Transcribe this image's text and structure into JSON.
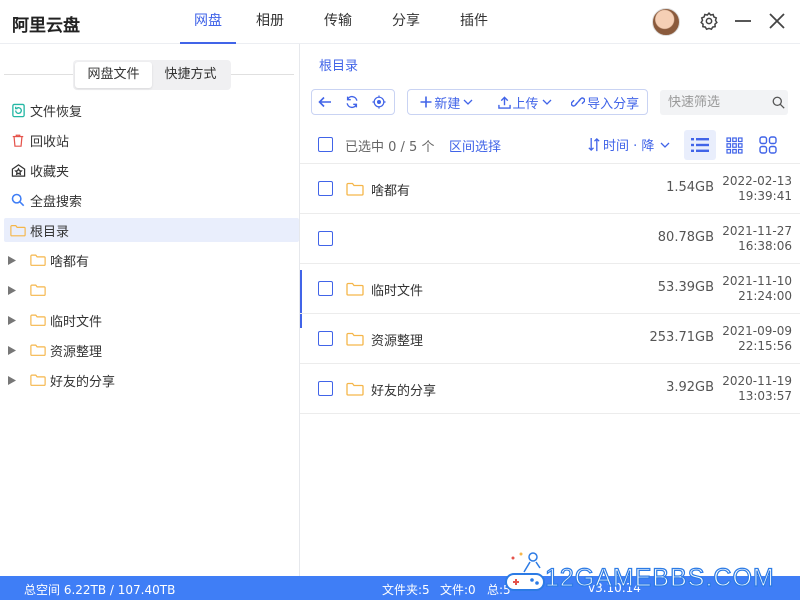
{
  "app": {
    "title": "阿里云盘"
  },
  "nav": {
    "tabs": [
      {
        "label": "网盘",
        "active": true
      },
      {
        "label": "相册"
      },
      {
        "label": "传输"
      },
      {
        "label": "分享"
      },
      {
        "label": "插件"
      }
    ]
  },
  "window_icons": [
    "settings-gear-icon",
    "minimize-icon",
    "close-icon"
  ],
  "sidebar": {
    "segments": [
      "网盘文件",
      "快捷方式"
    ],
    "active_segment": "网盘文件",
    "items": [
      {
        "label": "文件恢复",
        "icon": "file-restore-icon",
        "color": "#23b7a4"
      },
      {
        "label": "回收站",
        "icon": "trash-icon",
        "color": "#e5534b"
      },
      {
        "label": "收藏夹",
        "icon": "favorites-icon",
        "color": "#333333"
      },
      {
        "label": "全盘搜索",
        "icon": "search-icon",
        "color": "#3f7ef6"
      },
      {
        "label": "根目录",
        "icon": "folder-icon",
        "color": "#f5b64a",
        "selected": true
      }
    ],
    "tree": [
      {
        "label": "啥都有"
      },
      {
        "label": ""
      },
      {
        "label": "临时文件"
      },
      {
        "label": "资源整理"
      },
      {
        "label": "好友的分享"
      }
    ]
  },
  "main": {
    "breadcrumb": "根目录",
    "toolbar": {
      "nav_buttons": [
        "back-arrow-icon",
        "refresh-icon",
        "locate-icon"
      ],
      "new_label": "新建",
      "upload_label": "上传",
      "import_share_label": "导入分享"
    },
    "search": {
      "placeholder": "快速筛选",
      "value": ""
    },
    "list_header": {
      "selected_text": "已选中 0 / 5 个",
      "range_select": "区间选择",
      "sort_label": "时间 · 降"
    },
    "files": [
      {
        "name": "啥都有",
        "size": "1.54GB",
        "date": "2022-02-13",
        "time": "19:39:41",
        "folder_icon": true
      },
      {
        "name": "",
        "size": "80.78GB",
        "date": "2021-11-27",
        "time": "16:38:06",
        "folder_icon": false
      },
      {
        "name": "临时文件",
        "size": "53.39GB",
        "date": "2021-11-10",
        "time": "21:24:00",
        "folder_icon": true
      },
      {
        "name": "资源整理",
        "size": "253.71GB",
        "date": "2021-09-09",
        "time": "22:15:56",
        "folder_icon": true
      },
      {
        "name": "好友的分享",
        "size": "3.92GB",
        "date": "2020-11-19",
        "time": "13:03:57",
        "folder_icon": true
      }
    ]
  },
  "status": {
    "space": "总空间 6.22TB / 107.40TB",
    "folders": "文件夹:5",
    "files": "文件:0",
    "total": "总:5",
    "version": "v3.10.14"
  },
  "watermark": {
    "text": "12GAMEBBS.COM"
  },
  "colors": {
    "accent": "#4164e8",
    "statusbar": "#3f7ef6",
    "folder": "#f5b64a",
    "selected_bg": "#e9eefc"
  }
}
